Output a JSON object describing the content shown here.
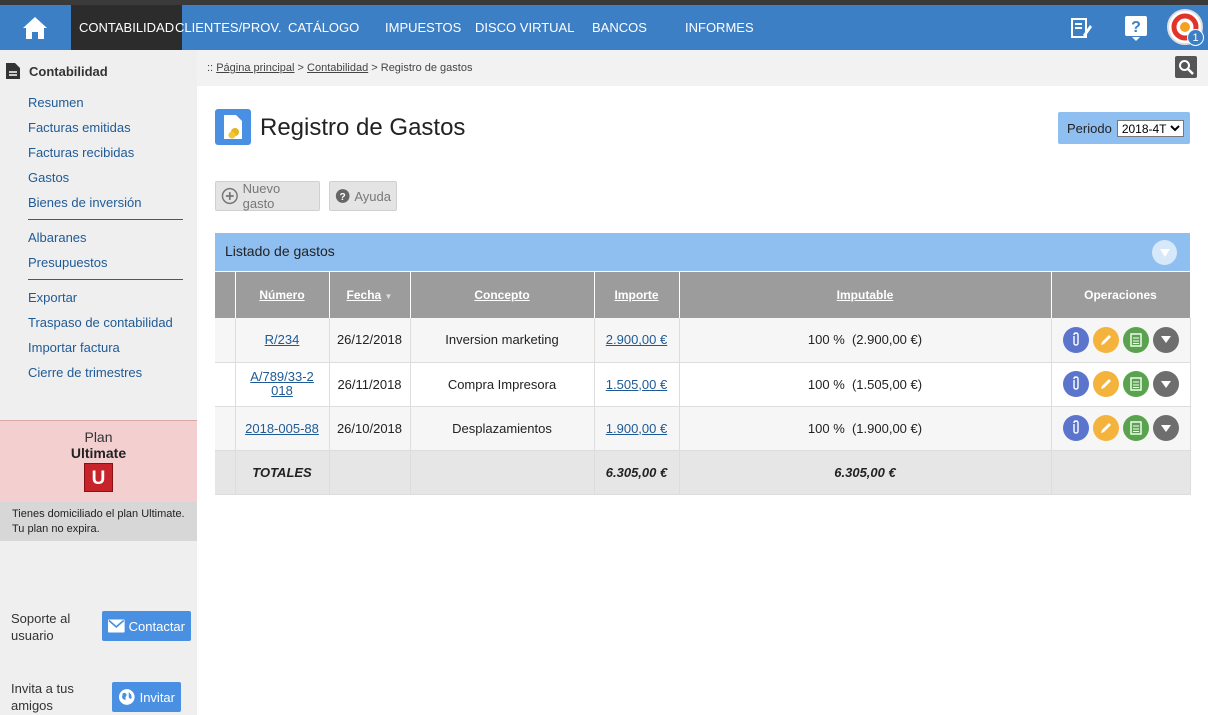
{
  "topbar": {
    "nav": [
      {
        "label": "CONTABILIDAD",
        "active": true
      },
      {
        "label": "CLIENTES/PROV.",
        "active": false
      },
      {
        "label": "CATÁLOGO",
        "active": false
      },
      {
        "label": "IMPUESTOS",
        "active": false
      },
      {
        "label": "DISCO VIRTUAL",
        "active": false
      },
      {
        "label": "BANCOS",
        "active": false
      },
      {
        "label": "INFORMES",
        "active": false
      }
    ],
    "icons": [
      "home-icon",
      "notes-icon",
      "help-icon",
      "avatar"
    ],
    "notification_count": "1"
  },
  "sidebar": {
    "title": "Contabilidad",
    "groups": [
      [
        "Resumen",
        "Facturas emitidas",
        "Facturas recibidas",
        "Gastos",
        "Bienes de inversión"
      ],
      [
        "Albaranes",
        "Presupuestos"
      ],
      [
        "Exportar",
        "Traspaso de contabilidad",
        "Importar factura",
        "Cierre de trimestres"
      ]
    ],
    "plan": {
      "label": "Plan",
      "name": "Ultimate",
      "badge": "U"
    },
    "plan_note": "Tienes domiciliado el plan Ultimate. Tu plan no expira.",
    "support": {
      "text": "Soporte al usuario",
      "button": "Contactar"
    },
    "invite": {
      "text": "Invita a tus amigos",
      "button": "Invitar"
    }
  },
  "breadcrumb": {
    "prefix": "::",
    "items": [
      "Página principal",
      "Contabilidad"
    ],
    "current": "Registro de gastos",
    "separator": ">"
  },
  "page": {
    "title": "Registro de Gastos"
  },
  "periodo": {
    "label": "Periodo",
    "value": "2018-4T"
  },
  "actions": {
    "new": "Nuevo gasto",
    "help": "Ayuda"
  },
  "panel": {
    "title": "Listado de gastos"
  },
  "table": {
    "headers": {
      "numero": "Número",
      "fecha": "Fecha",
      "concepto": "Concepto",
      "importe": "Importe",
      "imputable": "Imputable",
      "operaciones": "Operaciones"
    },
    "rows": [
      {
        "numero": "R/234",
        "fecha": "26/12/2018",
        "concepto": "Inversion marketing",
        "importe": "2.900,00 €",
        "imputable": "100 %  (2.900,00 €)"
      },
      {
        "numero": "A/789/33-2018",
        "fecha": "26/11/2018",
        "concepto": "Compra Impresora",
        "importe": "1.505,00 €",
        "imputable": "100 %  (1.505,00 €)"
      },
      {
        "numero": "2018-005-88",
        "fecha": "26/10/2018",
        "concepto": "Desplazamientos",
        "importe": "1.900,00 €",
        "imputable": "100 %  (1.900,00 €)"
      }
    ],
    "totals": {
      "label": "TOTALES",
      "importe": "6.305,00 €",
      "imputable": "6.305,00 €"
    },
    "operation_icons": [
      "attach-icon",
      "edit-icon",
      "document-icon",
      "more-icon"
    ]
  },
  "colors": {
    "topbar": "#3d7fc4",
    "active_nav": "#2c2c2c",
    "panel": "#8fbff0",
    "attach": "#5b74cc",
    "edit": "#f3b33d",
    "document": "#5aa34e",
    "more": "#6e6e6e",
    "plan_bg": "#f4cfd0",
    "plan_badge": "#c6232b"
  }
}
